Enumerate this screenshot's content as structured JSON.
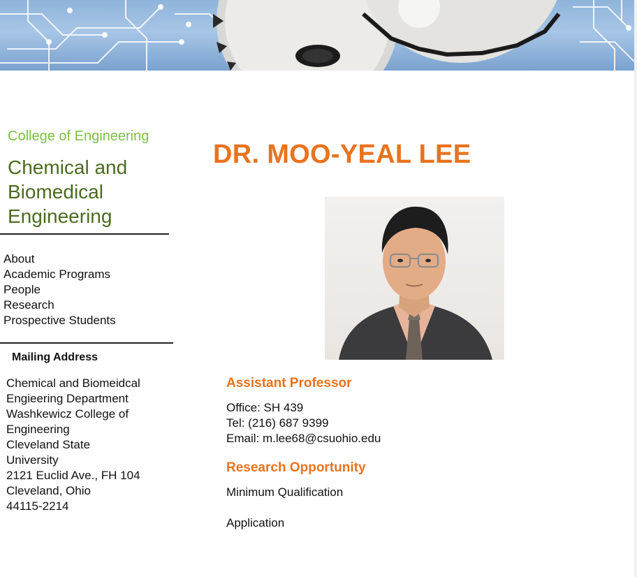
{
  "sidebar": {
    "college_label": "College of Engineering",
    "department_title": "Chemical and Biomedical Engineering",
    "nav_items": [
      {
        "label": "About"
      },
      {
        "label": "Academic Programs"
      },
      {
        "label": "People"
      },
      {
        "label": "Research"
      },
      {
        "label": "Prospective Students"
      }
    ],
    "mailing_address_heading": "Mailing Address",
    "address_lines": [
      "Chemical and Biomeidcal",
      "Engieering Department",
      "Washkewicz College of",
      "Engineering",
      "Cleveland State",
      "University",
      "2121 Euclid Ave., FH 104",
      "Cleveland, Ohio",
      "44115-2214"
    ]
  },
  "profile": {
    "name": "DR. MOO-YEAL LEE",
    "position_title": "Assistant Professor",
    "office": "Office: SH 439",
    "tel": "Tel: (216) 687 9399",
    "email": "Email: m.lee68@csuohio.edu",
    "research_heading": "Research Opportunity",
    "links": {
      "minimum_qualification": "Minimum Qualification",
      "application": "Application"
    }
  },
  "colors": {
    "accent_orange": "#e8731f",
    "college_green": "#7ec142",
    "dept_green": "#4a6b1f"
  }
}
